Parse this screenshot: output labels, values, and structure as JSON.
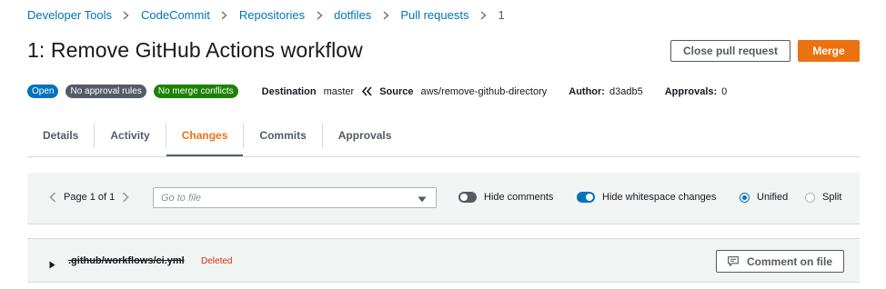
{
  "breadcrumb": {
    "items": [
      "Developer Tools",
      "CodeCommit",
      "Repositories",
      "dotfiles",
      "Pull requests"
    ],
    "current": "1"
  },
  "page": {
    "title": "1: Remove GitHub Actions workflow"
  },
  "actions": {
    "close_label": "Close pull request",
    "merge_label": "Merge"
  },
  "meta": {
    "badges": {
      "status": "Open",
      "approval_rules": "No approval rules",
      "merge_conflicts": "No merge conflicts"
    },
    "destination_label": "Destination",
    "destination_value": "master",
    "source_label": "Source",
    "source_value": "aws/remove-github-directory",
    "author_label": "Author:",
    "author_value": "d3adb5",
    "approvals_label": "Approvals:",
    "approvals_value": "0"
  },
  "tabs": [
    {
      "label": "Details",
      "active": false
    },
    {
      "label": "Activity",
      "active": false
    },
    {
      "label": "Changes",
      "active": true
    },
    {
      "label": "Commits",
      "active": false
    },
    {
      "label": "Approvals",
      "active": false
    }
  ],
  "toolbar": {
    "page_text": "Page 1 of 1",
    "goto_placeholder": "Go to file",
    "hide_comments_label": "Hide comments",
    "hide_comments_on": false,
    "hide_whitespace_label": "Hide whitespace changes",
    "hide_whitespace_on": true,
    "unified_label": "Unified",
    "split_label": "Split",
    "view_mode": "Unified"
  },
  "files": [
    {
      "name": ".github/workflows/ci.yml",
      "status": "Deleted",
      "comment_label": "Comment on file"
    }
  ],
  "colors": {
    "accent": "#ec7211",
    "link": "#0073bb",
    "deleted": "#d13212",
    "success": "#1d8102"
  }
}
